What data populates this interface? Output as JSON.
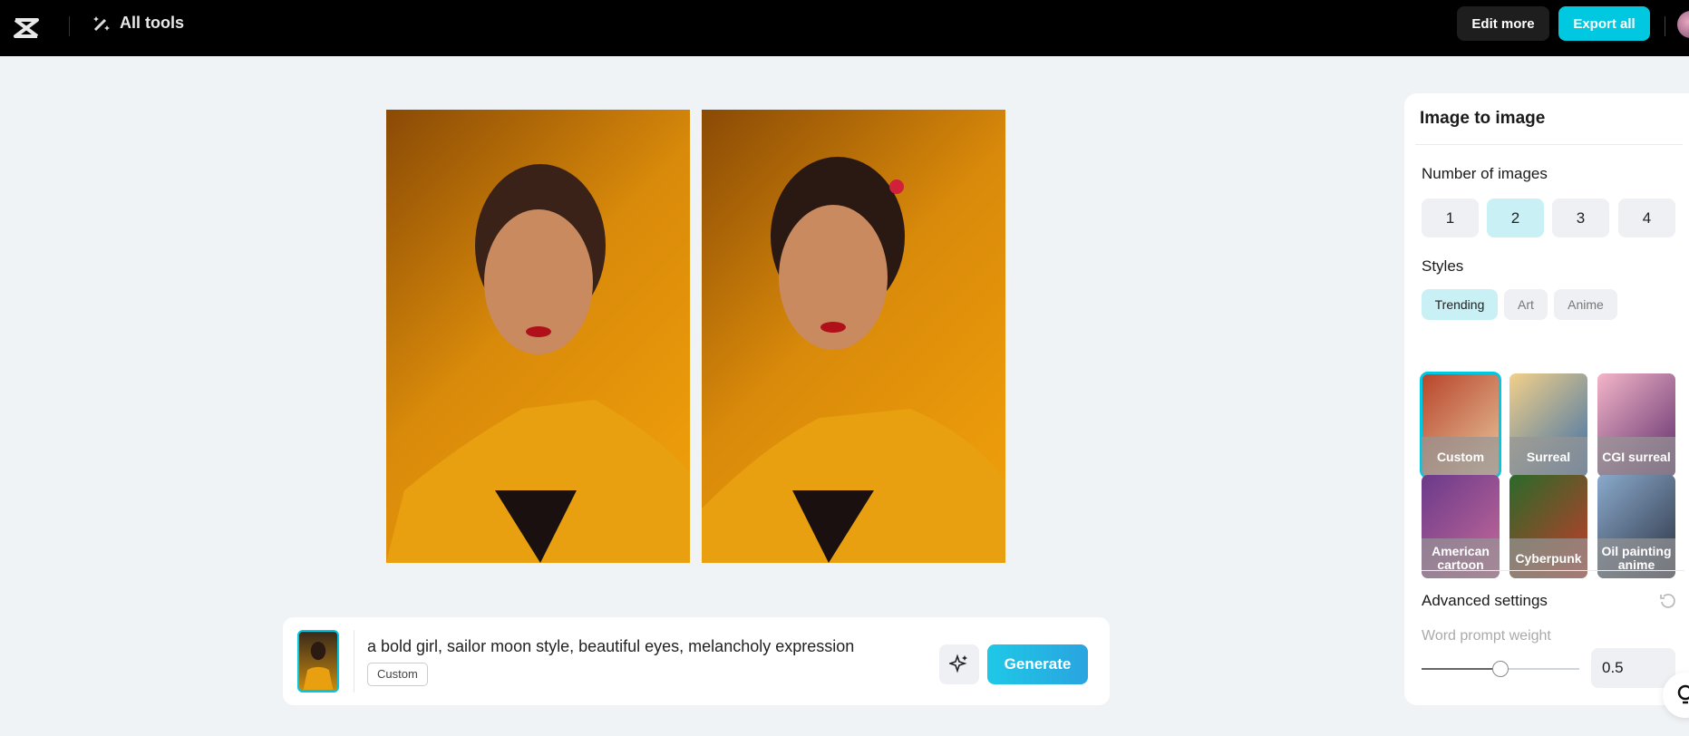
{
  "header": {
    "all_tools": "All tools",
    "edit_more": "Edit more",
    "export_all": "Export all"
  },
  "panel": {
    "title": "Image to image",
    "number_label": "Number of images",
    "numbers": [
      "1",
      "2",
      "3",
      "4"
    ],
    "selected_number": "2",
    "styles_label": "Styles",
    "style_tabs": [
      "Trending",
      "Art",
      "Anime"
    ],
    "selected_tab": "Trending",
    "styles": [
      {
        "label": "Custom",
        "selected": true,
        "colors": [
          "#b8442a",
          "#e9c9a0"
        ]
      },
      {
        "label": "Surreal",
        "colors": [
          "#f2d08a",
          "#3a6ea8"
        ]
      },
      {
        "label": "CGI surreal",
        "colors": [
          "#f3b5c8",
          "#5a2a6a"
        ]
      },
      {
        "label": "American cartoon",
        "colors": [
          "#6a3a8a",
          "#c86a9a"
        ]
      },
      {
        "label": "Cyberpunk",
        "colors": [
          "#2a6a2a",
          "#c83a2a"
        ]
      },
      {
        "label": "Oil painting anime",
        "colors": [
          "#8aaacc",
          "#2a3040"
        ]
      }
    ],
    "advanced_label": "Advanced settings",
    "word_prompt_weight_label": "Word prompt weight",
    "word_prompt_weight": "0.5",
    "word_prompt_weight_fraction": 0.5
  },
  "prompt": {
    "text": "a bold girl, sailor moon style, beautiful eyes, melancholy expression",
    "style_tag": "Custom",
    "generate": "Generate"
  },
  "colors": {
    "accent": "#00c8e0",
    "header_bg": "#000000",
    "selected_bg": "#c9f0f5"
  }
}
